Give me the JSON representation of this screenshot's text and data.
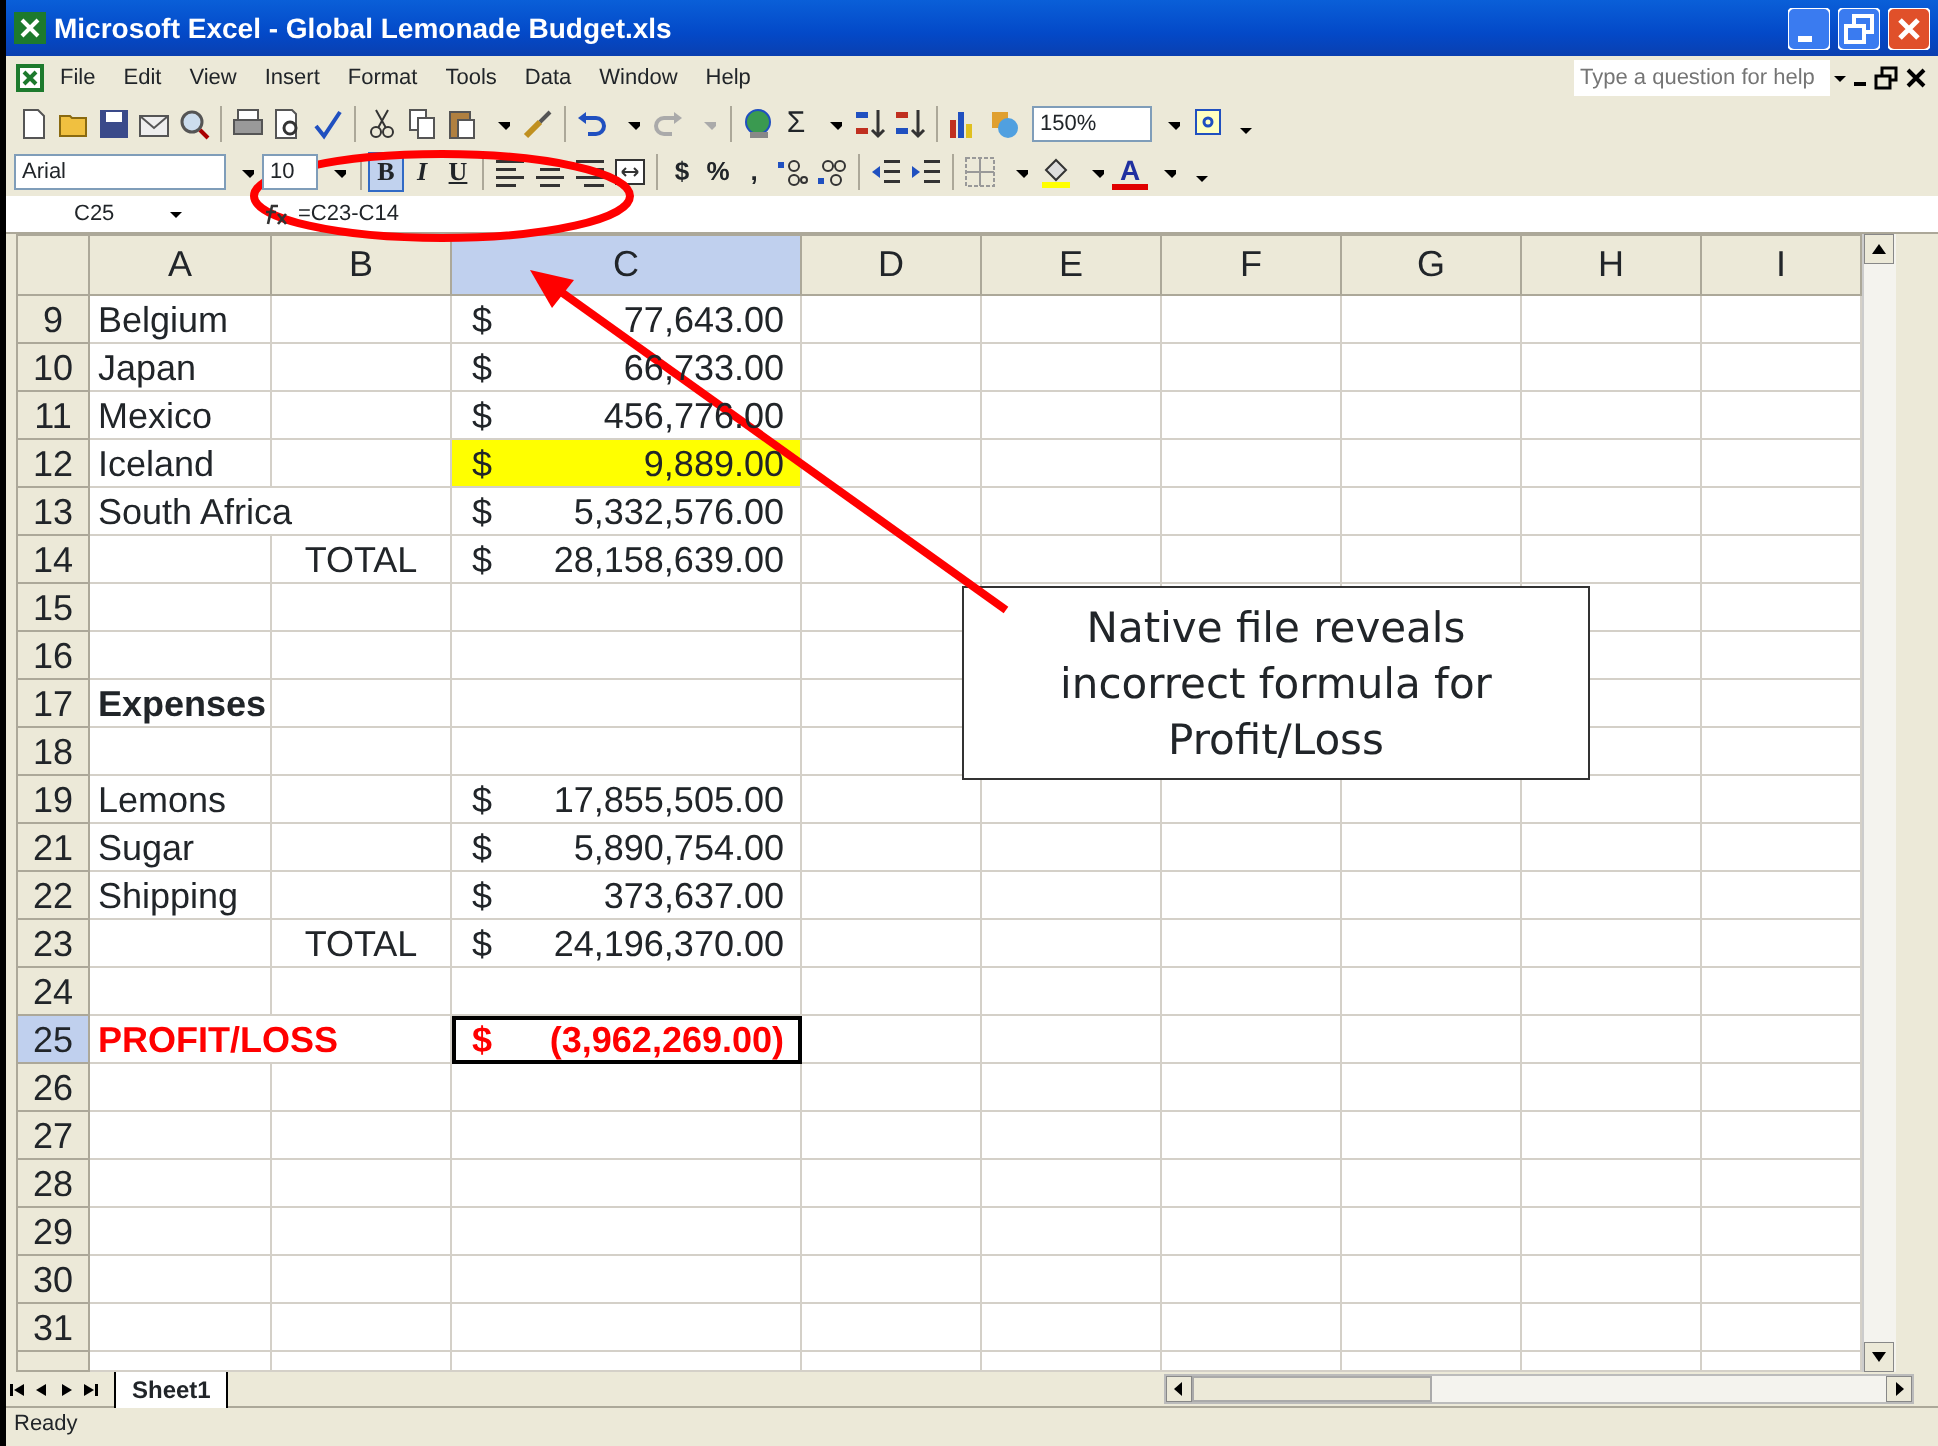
{
  "window": {
    "title": "Microsoft Excel - Global Lemonade Budget.xls"
  },
  "menu": [
    "File",
    "Edit",
    "View",
    "Insert",
    "Format",
    "Tools",
    "Data",
    "Window",
    "Help"
  ],
  "help_box": {
    "placeholder": "Type a question for help"
  },
  "standard_toolbar": {
    "sum_symbol": "Σ",
    "zoom": "150%"
  },
  "formatting_toolbar": {
    "font": "Arial",
    "font_size": "10",
    "bold": "B",
    "italic": "I",
    "underline": "U",
    "currency": "$",
    "percent": "%",
    "comma": ",",
    "font_color": "A"
  },
  "formula_bar": {
    "name_box": "C25",
    "formula": "=C23-C14"
  },
  "columns": [
    {
      "label": "A",
      "selected": false
    },
    {
      "label": "B",
      "selected": false
    },
    {
      "label": "C",
      "selected": true
    },
    {
      "label": "D",
      "selected": false
    },
    {
      "label": "E",
      "selected": false
    },
    {
      "label": "F",
      "selected": false
    },
    {
      "label": "G",
      "selected": false
    },
    {
      "label": "H",
      "selected": false
    },
    {
      "label": "I",
      "selected": false
    }
  ],
  "rows": [
    {
      "number": "9",
      "selected": false,
      "kind": "data",
      "a": "Belgium",
      "c_symbol": "$",
      "c_value": "77,643.00"
    },
    {
      "number": "10",
      "selected": false,
      "kind": "data",
      "a": "Japan",
      "c_symbol": "$",
      "c_value": "66,733.00"
    },
    {
      "number": "11",
      "selected": false,
      "kind": "data",
      "a": "Mexico",
      "c_symbol": "$",
      "c_value": "456,776.00"
    },
    {
      "number": "12",
      "selected": false,
      "kind": "highlight",
      "a": "Iceland",
      "c_symbol": "$",
      "c_value": "9,889.00"
    },
    {
      "number": "13",
      "selected": false,
      "kind": "data",
      "a": "South Africa",
      "c_symbol": "$",
      "c_value": "5,332,576.00"
    },
    {
      "number": "14",
      "selected": false,
      "kind": "data",
      "b": "TOTAL",
      "c_symbol": "$",
      "c_value": "28,158,639.00"
    },
    {
      "number": "15",
      "selected": false,
      "kind": "data"
    },
    {
      "number": "16",
      "selected": false,
      "kind": "data"
    },
    {
      "number": "17",
      "selected": false,
      "kind": "heading",
      "a": "Expenses"
    },
    {
      "number": "18",
      "selected": false,
      "kind": "data"
    },
    {
      "number": "19",
      "selected": false,
      "kind": "data",
      "a": "Lemons",
      "c_symbol": "$",
      "c_value": "17,855,505.00"
    },
    {
      "number": "21",
      "selected": false,
      "kind": "data",
      "a": "Sugar",
      "c_symbol": "$",
      "c_value": "5,890,754.00"
    },
    {
      "number": "22",
      "selected": false,
      "kind": "data",
      "a": "Shipping",
      "c_symbol": "$",
      "c_value": "373,637.00"
    },
    {
      "number": "23",
      "selected": false,
      "kind": "data",
      "b": "TOTAL",
      "c_symbol": "$",
      "c_value": "24,196,370.00"
    },
    {
      "number": "24",
      "selected": false,
      "kind": "data"
    },
    {
      "number": "25",
      "selected": true,
      "kind": "result",
      "a": "PROFIT/LOSS",
      "c_symbol": "$",
      "c_value": "(3,962,269.00)"
    },
    {
      "number": "26",
      "selected": false,
      "kind": "data"
    },
    {
      "number": "27",
      "selected": false,
      "kind": "data"
    },
    {
      "number": "28",
      "selected": false,
      "kind": "data"
    },
    {
      "number": "29",
      "selected": false,
      "kind": "data"
    },
    {
      "number": "30",
      "selected": false,
      "kind": "data"
    },
    {
      "number": "31",
      "selected": false,
      "kind": "data"
    }
  ],
  "sheet_tabs": [
    {
      "label": "Sheet1",
      "selected": true
    }
  ],
  "status_bar": "Ready",
  "callout": {
    "text": "Native file reveals incorrect formula for Profit/Loss"
  }
}
